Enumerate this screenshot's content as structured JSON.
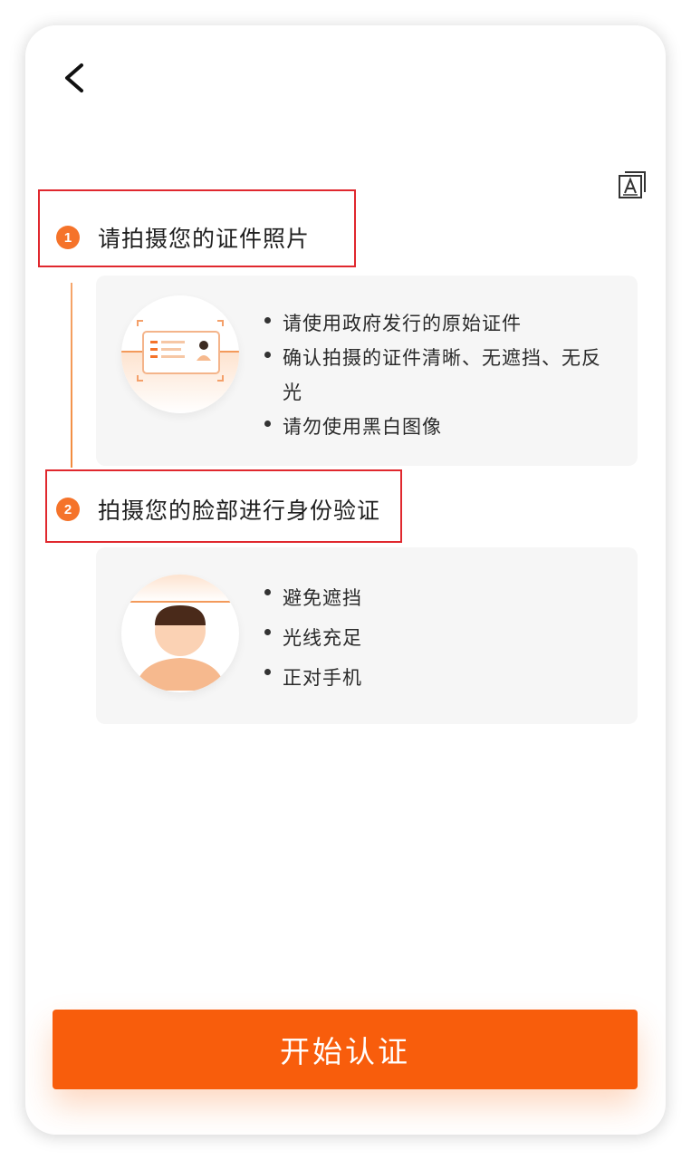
{
  "nav": {
    "back_icon": "chevron-left-icon",
    "accessibility_icon": "font-size-icon"
  },
  "steps": [
    {
      "number": "1",
      "title": "请拍摄您的证件照片",
      "illustration": "id-card-icon",
      "tips": [
        "请使用政府发行的原始证件",
        "确认拍摄的证件清晰、无遮挡、无反光",
        "请勿使用黑白图像"
      ]
    },
    {
      "number": "2",
      "title": "拍摄您的脸部进行身份验证",
      "illustration": "face-icon",
      "tips": [
        "避免遮挡",
        "光线充足",
        "正对手机"
      ]
    }
  ],
  "colors": {
    "accent": "#f85d0c",
    "step_badge": "#f5732a",
    "highlight_box": "#e0282e"
  },
  "action": {
    "start_label": "开始认证"
  }
}
